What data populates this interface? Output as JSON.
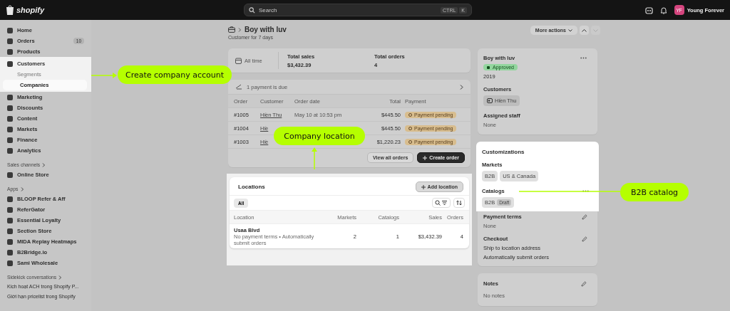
{
  "topbar": {
    "logo": "shopify",
    "search": {
      "placeholder": "Search",
      "keys": [
        "CTRL",
        "K"
      ]
    },
    "user": {
      "initials": "YF",
      "name": "Young Forever"
    }
  },
  "sidebar": {
    "groups": [
      {
        "items": [
          {
            "label": "Home",
            "selected": false
          },
          {
            "label": "Orders",
            "badge": "10",
            "selected": false
          },
          {
            "label": "Products",
            "selected": false
          },
          {
            "label": "Customers",
            "selected": false,
            "highlighted": true,
            "children": [
              {
                "label": "Segments",
                "selected": false
              },
              {
                "label": "Companies",
                "selected": true
              }
            ]
          },
          {
            "label": "Marketing",
            "selected": false
          },
          {
            "label": "Discounts",
            "selected": false
          },
          {
            "label": "Content",
            "selected": false
          },
          {
            "label": "Markets",
            "selected": false
          },
          {
            "label": "Finance",
            "selected": false
          },
          {
            "label": "Analytics",
            "selected": false
          }
        ]
      },
      {
        "heading": "Sales channels",
        "items": [
          {
            "label": "Online Store",
            "selected": false
          }
        ]
      },
      {
        "heading": "Apps",
        "items": [
          {
            "label": "BLOOP Refer & Aff",
            "selected": false
          },
          {
            "label": "ReferGator",
            "selected": false
          },
          {
            "label": "Essential Loyalty",
            "selected": false
          },
          {
            "label": "Section Store",
            "selected": false
          },
          {
            "label": "MIDA Replay Heatmaps",
            "selected": false
          },
          {
            "label": "B2Bridge.io",
            "selected": false
          },
          {
            "label": "Sami Wholesale",
            "selected": false
          }
        ]
      },
      {
        "heading": "Sidekick conversations",
        "links": [
          "Kich hoạt ACH trong Shopify P...",
          "Giới hạn pricelist trong Shopify"
        ]
      }
    ]
  },
  "header": {
    "title": "Boy with luv",
    "subtitle": "Customer for 7 days",
    "more": "More actions",
    "prev_disabled": false,
    "next_disabled": true
  },
  "stats": {
    "range": "All time",
    "metrics": [
      {
        "label": "Total sales",
        "value": "$3,432.39"
      },
      {
        "label": "Total orders",
        "value": "4"
      }
    ]
  },
  "orders": {
    "banner": "1 payment is due",
    "columns": [
      "Order",
      "Customer",
      "Order date",
      "Total",
      "Payment"
    ],
    "rows": [
      {
        "order": "#1005",
        "customer": "Hiền Thu",
        "date": "May 10 at 10:53 pm",
        "total": "$445.50",
        "payment": {
          "label": "Payment pending",
          "color": "#d8bd8e"
        }
      },
      {
        "order": "#1004",
        "customer": "Hiề",
        "total": "$445.50",
        "payment": {
          "label": "Payment pending",
          "color": "#d8bd8e"
        }
      },
      {
        "order": "#1003",
        "customer": "Hiề",
        "total": "$1,220.23",
        "payment": {
          "label": "Payment pending",
          "color": "#d8bd8e"
        }
      }
    ],
    "buttons": [
      {
        "label": "View all orders",
        "kind": "secondary"
      },
      {
        "label": "Create order",
        "kind": "primary"
      }
    ]
  },
  "locations": {
    "highlighted": true,
    "title": "Locations",
    "add_button": "Add location",
    "filters": [
      {
        "label": "All",
        "selected": true
      }
    ],
    "columns": [
      "Location",
      "Markets",
      "Catalogs",
      "Sales",
      "Orders"
    ],
    "rows": [
      {
        "name": "Usaa Blvd",
        "details": "No payment terms • Automatically submit orders",
        "markets": "2",
        "catalogs": "1",
        "sales": "$3,432.39",
        "orders": "4"
      }
    ]
  },
  "company": {
    "name": "Boy with luv",
    "status": {
      "label": "Approved",
      "color": "#93d69e"
    },
    "year": "2019",
    "customers": {
      "label": "Customers",
      "chip": "Hiền Thu"
    },
    "staff": {
      "label": "Assigned staff",
      "value": "None"
    }
  },
  "customizations": {
    "highlighted": true,
    "title": "Customizations",
    "markets": {
      "label": "Markets",
      "chips": [
        "B2B",
        "US & Canada"
      ]
    },
    "catalogs": {
      "label": "Catalogs",
      "chip": "B2B",
      "badge": {
        "label": "Draft",
        "color": "#c2c2c2"
      }
    },
    "payment_terms": {
      "label": "Payment terms",
      "value": "None"
    },
    "checkout": {
      "label": "Checkout",
      "lines": [
        "Ship to location address",
        "Automatically submit orders"
      ]
    }
  },
  "notes": {
    "title": "Notes",
    "value": "No notes"
  },
  "annotations": [
    "Create company account",
    "Company location",
    "B2B catalog"
  ]
}
